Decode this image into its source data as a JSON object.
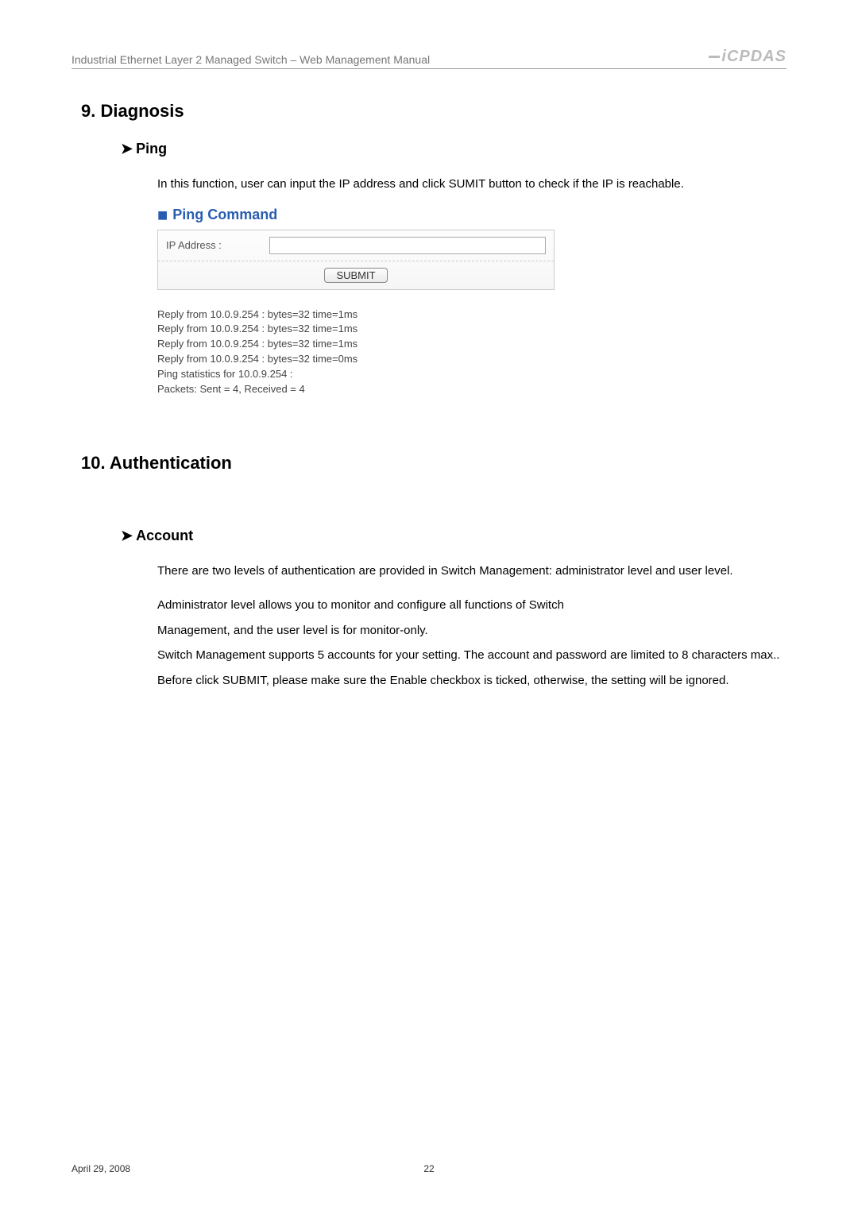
{
  "header": {
    "title": "Industrial Ethernet Layer 2 Managed Switch – Web Management Manual",
    "logo": "iCPDAS"
  },
  "section9": {
    "heading": "9.    Diagnosis",
    "ping_heading": "Ping",
    "ping_body": "In this function, user can input the IP address and click SUMIT button to check if the IP is reachable.",
    "ping_command_title": "Ping Command",
    "ip_label": "IP Address :",
    "submit_label": "SUBMIT",
    "ping_output": "Reply from 10.0.9.254 : bytes=32 time=1ms\nReply from 10.0.9.254 : bytes=32 time=1ms\nReply from 10.0.9.254 : bytes=32 time=1ms\nReply from 10.0.9.254 : bytes=32 time=0ms\nPing statistics for 10.0.9.254 :\nPackets: Sent = 4, Received = 4"
  },
  "section10": {
    "heading": "10.  Authentication",
    "account_heading": "Account",
    "p1": "There are two levels of authentication are provided in Switch Management: administrator level and user level.",
    "p2": "Administrator level allows you to monitor and configure all functions of Switch",
    "p3": "Management, and the user level is for monitor-only.",
    "p4": "Switch Management supports 5 accounts for your setting. The account and password are limited to 8 characters max.. Before click SUBMIT, please make sure the Enable checkbox is ticked, otherwise, the setting will be ignored."
  },
  "footer": {
    "date": "April 29, 2008",
    "page": "22"
  }
}
